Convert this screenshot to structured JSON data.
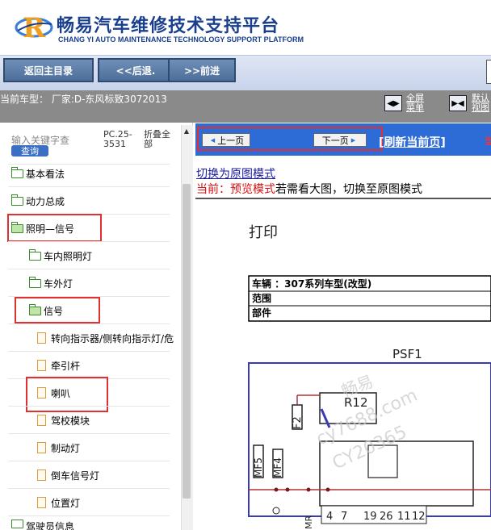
{
  "header": {
    "brand_cn": "畅易汽车维修技术支持平台",
    "brand_en": "CHANG YI AUTO MAINTENANCE TECHNOLOGY SUPPORT PLATFORM"
  },
  "nav": {
    "home": "返回主目录",
    "back": "<<后退.",
    "forward": ">>前进"
  },
  "info": {
    "model": "当前车型：  厂家:D-东风标致3072013",
    "fullscreen": "全屏菜单",
    "default": "默认视图"
  },
  "sidebar": {
    "search_placeholder": "输入关键字查",
    "search_button": "查询",
    "pc": "PC.25-3531",
    "collapse_all": "折叠全部",
    "items": [
      {
        "label": "基本看法",
        "type": "folder"
      },
      {
        "label": "动力总成",
        "type": "folder"
      },
      {
        "label": "照明—信号",
        "type": "folder-open"
      },
      {
        "label": "车内照明灯",
        "type": "folder"
      },
      {
        "label": "车外灯",
        "type": "folder"
      },
      {
        "label": "信号",
        "type": "folder-open"
      },
      {
        "label": "转向指示器/侧转向指示灯/危",
        "type": "doc"
      },
      {
        "label": "牵引杆",
        "type": "doc"
      },
      {
        "label": "喇叭",
        "type": "doc"
      },
      {
        "label": "驾校模块",
        "type": "doc"
      },
      {
        "label": "制动灯",
        "type": "doc"
      },
      {
        "label": "倒车信号灯",
        "type": "doc"
      },
      {
        "label": "位置灯",
        "type": "doc"
      },
      {
        "label": "驾驶员信息",
        "type": "folder"
      }
    ]
  },
  "content": {
    "prev": "上一页",
    "next": "下一页",
    "refresh": "[刷新当前页]",
    "pager_edge": "当",
    "mode_link": "切换为原图模式",
    "mode_current": "当前：预览模式",
    "mode_hint": "若需看大图，切换至原图模式",
    "doc": {
      "print": "打印",
      "vehicle_row": "车辆 ：307系列车型(改型)",
      "range_row": "范围",
      "part_row": "部件",
      "psf": "PSF1",
      "r12": "R12",
      "f2": "F2",
      "mf5": "MF5",
      "mf4": "MF4",
      "pins": [
        "4",
        "7",
        "19",
        "26",
        "11",
        "12"
      ],
      "mr": "MR",
      "watermark_1": "畅易",
      "watermark_2": "cy7688.com",
      "watermark_3": "CY20365"
    }
  },
  "colors": {
    "brand": "#1a3f8f",
    "highlight": "#e03030",
    "pager_bg": "#2d6cd6",
    "schematic_frame": "#3a3ab8",
    "schematic_wire": "#b03030"
  }
}
